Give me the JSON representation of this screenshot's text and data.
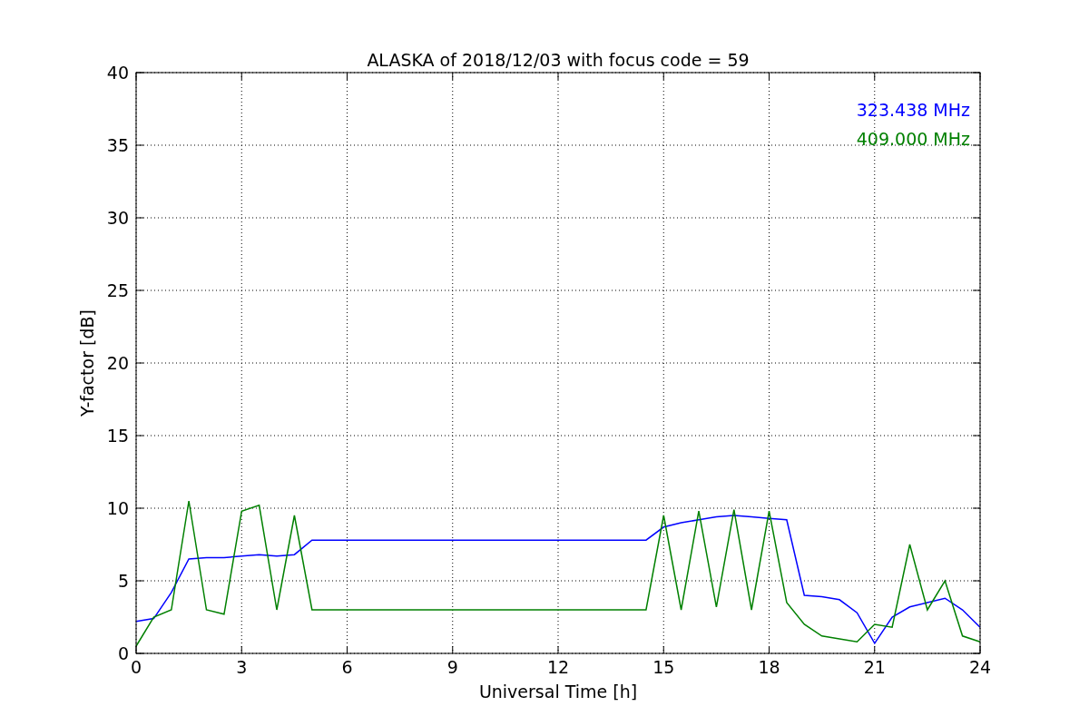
{
  "chart_data": {
    "type": "line",
    "title": "ALASKA of 2018/12/03 with focus code = 59",
    "xlabel": "Universal Time [h]",
    "ylabel": "Y-factor [dB]",
    "x": [
      0,
      0.5,
      1,
      1.5,
      2,
      2.5,
      3,
      3.5,
      4,
      4.5,
      5,
      5.5,
      6,
      6.5,
      7,
      7.5,
      8,
      8.5,
      9,
      9.5,
      10,
      10.5,
      11,
      11.5,
      12,
      12.5,
      13,
      13.5,
      14,
      14.5,
      15,
      15.5,
      16,
      16.5,
      17,
      17.5,
      18,
      18.5,
      19,
      19.5,
      20,
      20.5,
      21,
      21.5,
      22,
      22.5,
      23,
      23.5,
      24
    ],
    "series": [
      {
        "name": "323.438 MHz",
        "color": "#0000ff",
        "values": [
          2.2,
          2.4,
          4.2,
          6.5,
          6.6,
          6.6,
          6.7,
          6.8,
          6.7,
          6.8,
          7.8,
          7.8,
          7.8,
          7.8,
          7.8,
          7.8,
          7.8,
          7.8,
          7.8,
          7.8,
          7.8,
          7.8,
          7.8,
          7.8,
          7.8,
          7.8,
          7.8,
          7.8,
          7.8,
          7.8,
          8.7,
          9.0,
          9.2,
          9.4,
          9.5,
          9.4,
          9.3,
          9.2,
          4.0,
          3.9,
          3.7,
          2.8,
          0.7,
          2.5,
          3.2,
          3.5,
          3.8,
          3.0,
          1.8
        ]
      },
      {
        "name": "409.000 MHz",
        "color": "#008000",
        "values": [
          0.5,
          2.5,
          3.0,
          10.5,
          3.0,
          2.7,
          9.8,
          10.2,
          3.0,
          9.5,
          3.0,
          3.0,
          3.0,
          3.0,
          3.0,
          3.0,
          3.0,
          3.0,
          3.0,
          3.0,
          3.0,
          3.0,
          3.0,
          3.0,
          3.0,
          3.0,
          3.0,
          3.0,
          3.0,
          3.0,
          9.5,
          3.0,
          9.8,
          3.2,
          9.9,
          3.0,
          9.8,
          3.5,
          2.0,
          1.2,
          1.0,
          0.8,
          2.0,
          1.8,
          7.5,
          3.0,
          5.0,
          1.2,
          0.8
        ]
      }
    ],
    "xlim": [
      0,
      24
    ],
    "ylim": [
      0,
      40
    ],
    "xticks": [
      0,
      3,
      6,
      9,
      12,
      15,
      18,
      21,
      24
    ],
    "yticks": [
      0,
      5,
      10,
      15,
      20,
      25,
      30,
      35,
      40
    ],
    "grid": true
  }
}
